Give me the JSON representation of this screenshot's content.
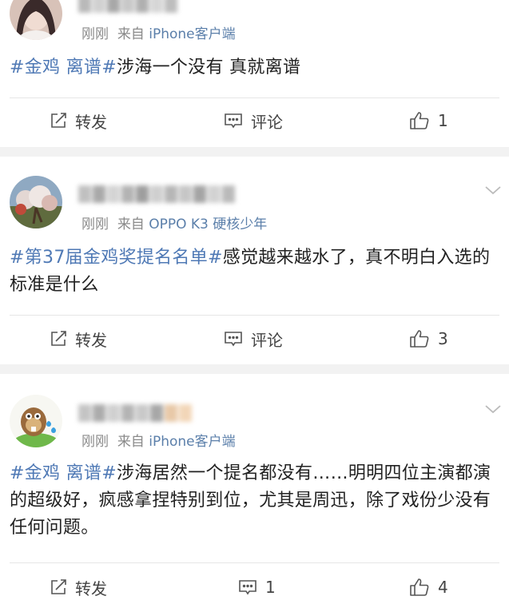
{
  "posts": [
    {
      "meta_time": "刚刚",
      "meta_from": "来自",
      "meta_source": "iPhone客户端",
      "tag": "#金鸡 离谱#",
      "text": "涉海一个没有 真就离谱",
      "repost_label": "转发",
      "comment_label": "评论",
      "like_count": "1"
    },
    {
      "meta_time": "刚刚",
      "meta_from": "来自",
      "meta_source": "OPPO K3 硬核少年",
      "tag": "#第37届金鸡奖提名名单#",
      "text": "感觉越来越水了，真不明白入选的标准是什么",
      "repost_label": "转发",
      "comment_label": "评论",
      "like_count": "3"
    },
    {
      "meta_time": "刚刚",
      "meta_from": "来自",
      "meta_source": "iPhone客户端",
      "tag": "#金鸡 离谱#",
      "text": "涉海居然一个提名都没有……明明四位主演都演的超级好，疯感拿捏特别到位，尤其是周迅，除了戏份少没有任何问题。",
      "repost_label": "转发",
      "comment_label": "1",
      "like_count": "4"
    }
  ],
  "icons": {
    "repost": "repost-icon",
    "comment": "comment-icon",
    "like": "thumbs-up-icon",
    "menu": "chevron-down-icon"
  },
  "colors": {
    "topic": "#4f79b5",
    "source": "#5b7faa",
    "meta": "#8a8a8a",
    "separator": "#f2f2f2"
  }
}
